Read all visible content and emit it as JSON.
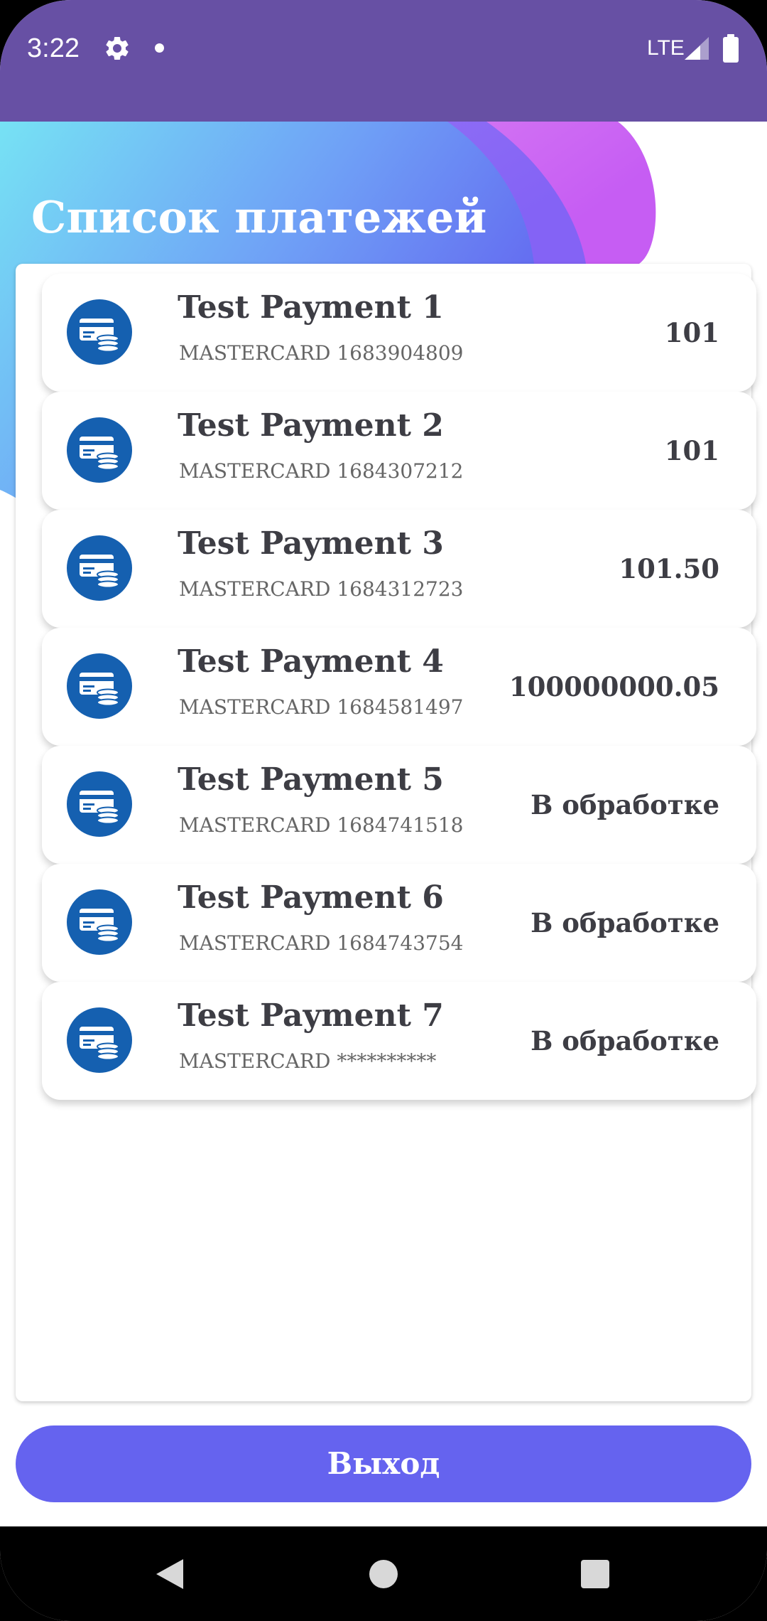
{
  "status_bar": {
    "time": "3:22",
    "network": "LTE",
    "icons": [
      "gear-icon",
      "notification-dot-icon",
      "signal-icon",
      "battery-icon"
    ]
  },
  "header": {
    "title": "Список платежей"
  },
  "payments": [
    {
      "title": "Test Payment 1",
      "card": "MASTERCARD 1683904809",
      "amount": "101",
      "icon": "card-payment-icon"
    },
    {
      "title": "Test Payment 2",
      "card": "MASTERCARD 1684307212",
      "amount": "101",
      "icon": "card-payment-icon"
    },
    {
      "title": "Test Payment 3",
      "card": "MASTERCARD 1684312723",
      "amount": "101.50",
      "icon": "card-payment-icon"
    },
    {
      "title": "Test Payment 4",
      "card": "MASTERCARD 1684581497",
      "amount": "100000000.05",
      "icon": "card-payment-icon"
    },
    {
      "title": "Test Payment 5",
      "card": "MASTERCARD 1684741518",
      "amount": "В обработке",
      "icon": "card-payment-icon"
    },
    {
      "title": "Test Payment 6",
      "card": "MASTERCARD 1684743754",
      "amount": "В обработке",
      "icon": "card-payment-icon"
    },
    {
      "title": "Test Payment 7",
      "card": "MASTERCARD **********",
      "amount": "В обработке",
      "icon": "card-payment-icon"
    }
  ],
  "actions": {
    "exit_label": "Выход"
  },
  "colors": {
    "status_bar": "#6750A4",
    "button": "#6563EF",
    "icon_blue": "#1560B0",
    "text_dark": "#3D3D44",
    "text_muted": "#666666"
  },
  "nav_bar": {
    "icons": [
      "back-icon",
      "home-icon",
      "recents-icon"
    ]
  }
}
